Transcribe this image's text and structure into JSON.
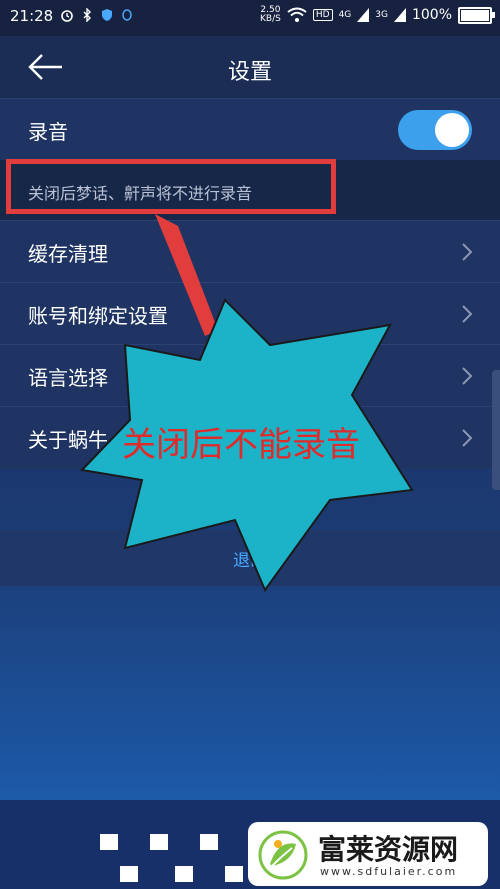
{
  "status_bar": {
    "time": "21:28",
    "speed_value": "2.50",
    "speed_unit": "KB/S",
    "hd_tag": "HD",
    "signal1_tag": "4G",
    "signal2_tag": "3G",
    "battery": "100%",
    "battery_level": 1.0
  },
  "header": {
    "title": "设置"
  },
  "settings": {
    "recording": {
      "label": "录音",
      "enabled": true
    },
    "recording_hint": "关闭后梦话、鼾声将不进行录音",
    "items": [
      {
        "label": "缓存清理"
      },
      {
        "label": "账号和绑定设置"
      },
      {
        "label": "语言选择"
      },
      {
        "label": "关于蜗牛"
      }
    ],
    "logout_label": "退出"
  },
  "annotation": {
    "callout_text": "关闭后不能录音",
    "highlight_color": "#e23d3d",
    "bubble_color": "#1cb3c8"
  },
  "watermark": {
    "name": "富莱资源网",
    "site": "www.sdfulaier.com"
  },
  "colors": {
    "accent": "#3da0ec",
    "header_bg": "#1b2c55",
    "row_bg": "#1f3463"
  }
}
